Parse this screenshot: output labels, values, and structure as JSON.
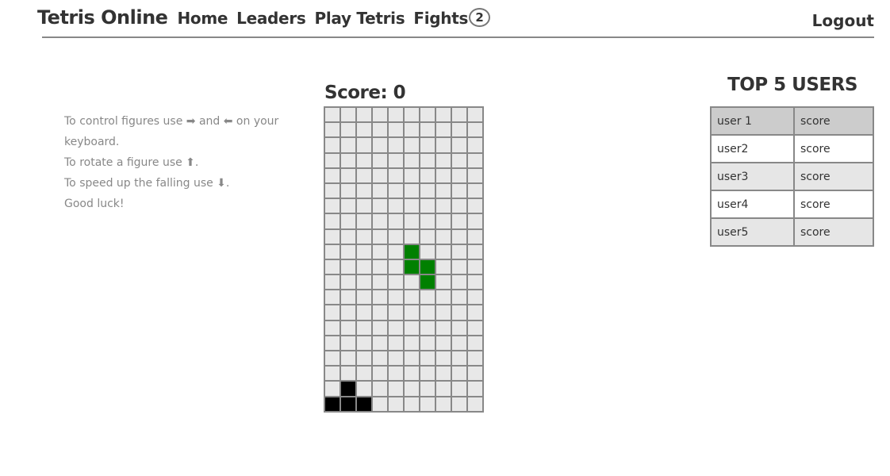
{
  "nav": {
    "brand": "Tetris Online",
    "items": [
      "Home",
      "Leaders",
      "Play Tetris",
      "Fights"
    ],
    "fights_badge": "2",
    "logout": "Logout"
  },
  "help": {
    "lines": [
      "To control figures use ➡ and ⬅ on your keyboard.",
      "To rotate a figure use  ⬆.",
      "To speed up the falling use ⬇.",
      "Good luck!"
    ]
  },
  "game": {
    "score_label": "Score: 0",
    "board": [
      "..........",
      "..........",
      "..........",
      "..........",
      "..........",
      "..........",
      "..........",
      "..........",
      "..........",
      ".....G....",
      ".....GG...",
      "......G...",
      "..........",
      "..........",
      "..........",
      "..........",
      "..........",
      "..........",
      ".B........",
      "BBB......."
    ],
    "colors": {
      "G": "#008000",
      "B": "#000000",
      "empty": "#e8e8e8"
    }
  },
  "leaders": {
    "title": "TOP 5 USERS",
    "rows": [
      [
        "user 1",
        "score"
      ],
      [
        "user2",
        "score"
      ],
      [
        "user3",
        "score"
      ],
      [
        "user4",
        "score"
      ],
      [
        "user5",
        "score"
      ]
    ]
  }
}
